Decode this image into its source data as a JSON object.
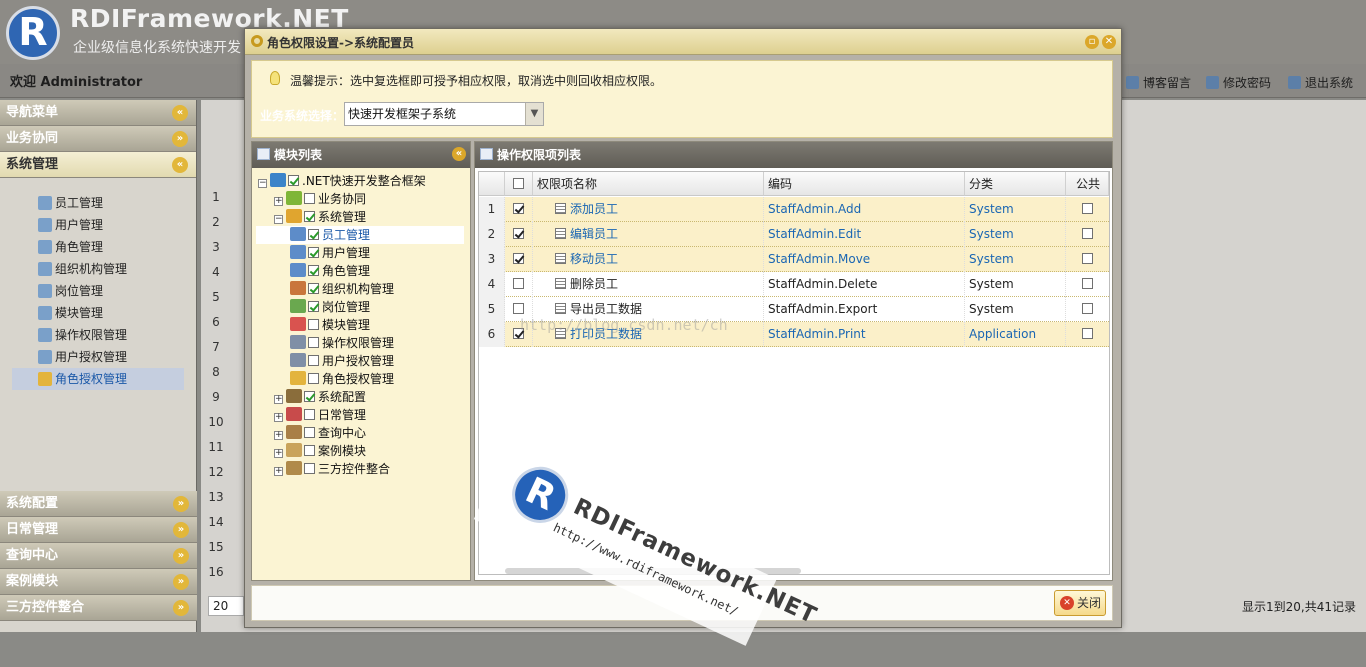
{
  "app": {
    "logo_letter": "R",
    "title": "RDIFramework.NET",
    "subtitle": "企业级信息化系统快速开发"
  },
  "userbar": {
    "welcome": "欢迎 Administrator",
    "links": [
      "博客留言",
      "修改密码",
      "退出系统"
    ]
  },
  "leftnav": {
    "header": "导航菜单",
    "sections_top": [
      "业务协同",
      "系统管理"
    ],
    "items": [
      "员工管理",
      "用户管理",
      "角色管理",
      "组织机构管理",
      "岗位管理",
      "模块管理",
      "操作权限管理",
      "用户授权管理",
      "角色授权管理"
    ],
    "selected_item": "角色授权管理",
    "sections_bottom": [
      "系统配置",
      "日常管理",
      "查询中心",
      "案例模块",
      "三方控件整合"
    ]
  },
  "background_grid": {
    "row_numbers": [
      "1",
      "2",
      "3",
      "4",
      "5",
      "6",
      "7",
      "8",
      "9",
      "10",
      "11",
      "12",
      "13",
      "14",
      "15",
      "16"
    ],
    "page_size": "20",
    "pager_text": "显示1到20,共41记录"
  },
  "modal": {
    "title": "角色权限设置->系统配置员",
    "tip": "温馨提示：选中复选框即可授予相应权限，取消选中则回收相应权限。",
    "biz_label": "业务系统选择：",
    "biz_value": "快速开发框架子系统",
    "tree_title": "模块列表",
    "grid_title": "操作权限项列表",
    "close_label": "关闭",
    "tree": [
      {
        "label": ".NET快速开发整合框架",
        "level": 0,
        "checked": true,
        "exp": "-"
      },
      {
        "label": "业务协同",
        "level": 1,
        "checked": false,
        "exp": "+"
      },
      {
        "label": "系统管理",
        "level": 1,
        "checked": true,
        "exp": "-"
      },
      {
        "label": "员工管理",
        "level": 2,
        "checked": true,
        "exp": ""
      },
      {
        "label": "用户管理",
        "level": 2,
        "checked": true,
        "exp": ""
      },
      {
        "label": "角色管理",
        "level": 2,
        "checked": true,
        "exp": ""
      },
      {
        "label": "组织机构管理",
        "level": 2,
        "checked": true,
        "exp": ""
      },
      {
        "label": "岗位管理",
        "level": 2,
        "checked": true,
        "exp": ""
      },
      {
        "label": "模块管理",
        "level": 2,
        "checked": false,
        "exp": ""
      },
      {
        "label": "操作权限管理",
        "level": 2,
        "checked": false,
        "exp": ""
      },
      {
        "label": "用户授权管理",
        "level": 2,
        "checked": false,
        "exp": ""
      },
      {
        "label": "角色授权管理",
        "level": 2,
        "checked": false,
        "exp": ""
      },
      {
        "label": "系统配置",
        "level": 1,
        "checked": true,
        "exp": "+"
      },
      {
        "label": "日常管理",
        "level": 1,
        "checked": false,
        "exp": "+"
      },
      {
        "label": "查询中心",
        "level": 1,
        "checked": false,
        "exp": "+"
      },
      {
        "label": "案例模块",
        "level": 1,
        "checked": false,
        "exp": "+"
      },
      {
        "label": "三方控件整合",
        "level": 1,
        "checked": false,
        "exp": "+"
      }
    ],
    "selected_tree_item": "员工管理",
    "columns": [
      "权限项名称",
      "编码",
      "分类",
      "公共"
    ],
    "rows": [
      {
        "no": "1",
        "checked": true,
        "name": "添加员工",
        "code": "StaffAdmin.Add",
        "category": "System",
        "public": false
      },
      {
        "no": "2",
        "checked": true,
        "name": "编辑员工",
        "code": "StaffAdmin.Edit",
        "category": "System",
        "public": false
      },
      {
        "no": "3",
        "checked": true,
        "name": "移动员工",
        "code": "StaffAdmin.Move",
        "category": "System",
        "public": false
      },
      {
        "no": "4",
        "checked": false,
        "name": "删除员工",
        "code": "StaffAdmin.Delete",
        "category": "System",
        "public": false
      },
      {
        "no": "5",
        "checked": false,
        "name": "导出员工数据",
        "code": "StaffAdmin.Export",
        "category": "System",
        "public": false
      },
      {
        "no": "6",
        "checked": true,
        "name": "打印员工数据",
        "code": "StaffAdmin.Print",
        "category": "Application",
        "public": false
      }
    ]
  },
  "watermark": {
    "logo_letter": "R",
    "name": "RDIFramework.NET",
    "url": "http://www.rdiframework.net/",
    "csdn": "http://blog.csdn.net/ch"
  }
}
